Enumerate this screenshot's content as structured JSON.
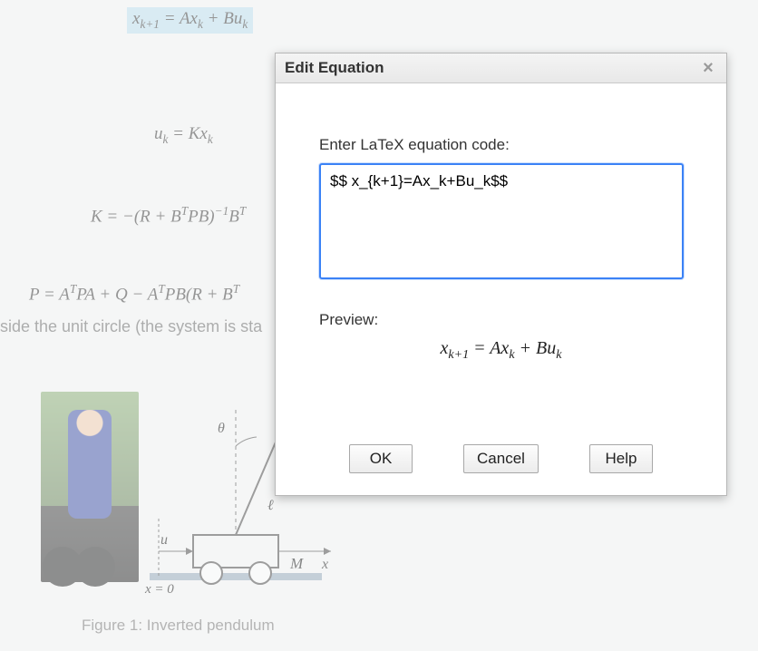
{
  "document": {
    "equations": {
      "highlighted_html": "x<span class='sub'>k+1</span> = Ax<span class='sub'>k</span> + Bu<span class='sub'>k</span>",
      "eq2_html": "u<span class='sub'>k</span> = Kx<span class='sub'>k</span>",
      "eq3_html": "K = −(R + B<span class='sup'>T</span>PB)<span class='sup'>−1</span>B<span class='sup'>T</span>",
      "eq4_html": "P = A<span class='sup'>T</span>PA + Q − A<span class='sup'>T</span>PB(R + B<span class='sup'>T</span>"
    },
    "body_text": "side the unit circle (the system is sta",
    "figure_caption": "Figure 1: Inverted pendulum",
    "diagram_labels": {
      "theta": "θ",
      "ell": "ℓ",
      "u": "u",
      "M": "M",
      "x_axis": "x",
      "x_origin": "x = 0"
    }
  },
  "dialog": {
    "title": "Edit Equation",
    "close_glyph": "×",
    "prompt_label": "Enter LaTeX equation code:",
    "code_value": "$$ x_{k+1}=Ax_k+Bu_k$$",
    "preview_label": "Preview:",
    "preview_html": "x<span class='sub'>k+1</span> = Ax<span class='sub'>k</span> + Bu<span class='sub'>k</span>",
    "buttons": {
      "ok": "OK",
      "cancel": "Cancel",
      "help": "Help"
    }
  }
}
